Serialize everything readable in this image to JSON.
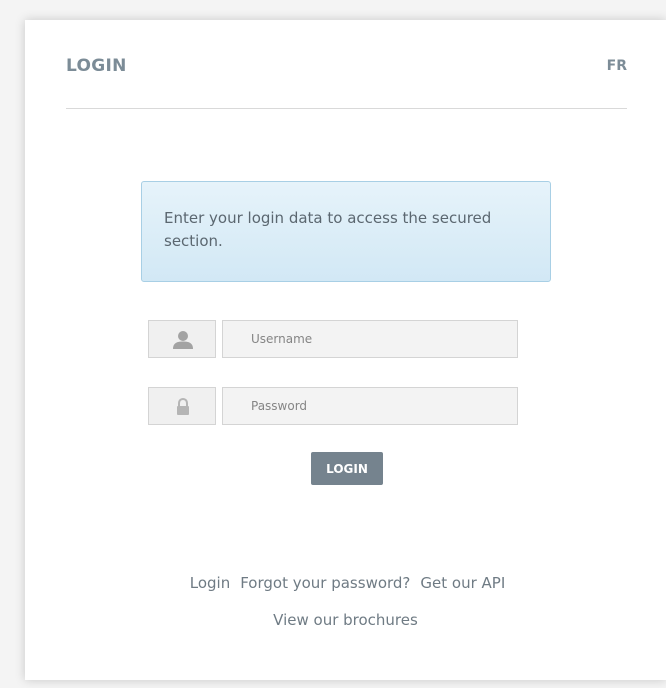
{
  "header": {
    "title": "LOGIN",
    "language_link": "FR"
  },
  "info_message": "Enter your login data to access the secured section.",
  "form": {
    "username": {
      "icon": "user-icon",
      "placeholder": "Username",
      "value": ""
    },
    "password": {
      "icon": "lock-icon",
      "placeholder": "Password",
      "value": ""
    },
    "submit_label": "LOGIN"
  },
  "footer": {
    "links": [
      "Login",
      "Forgot your password?",
      "Get our API",
      "View our brochures"
    ]
  },
  "colors": {
    "title_text": "#7c8c97",
    "info_border": "#a8cfe5",
    "info_background": "#dcedf7",
    "button_background": "#75838e",
    "input_background": "#f3f3f3"
  }
}
